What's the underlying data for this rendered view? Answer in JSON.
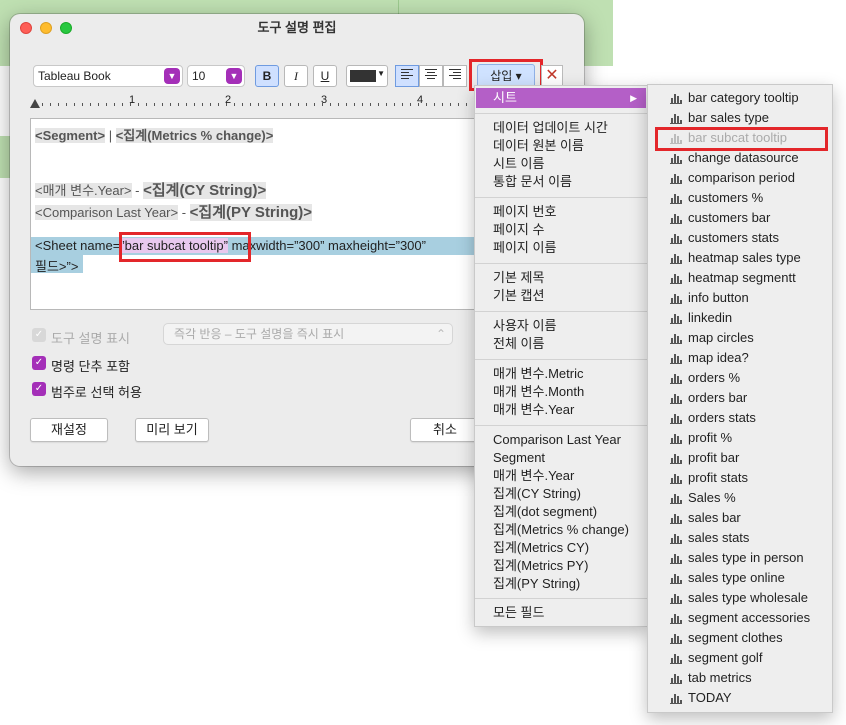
{
  "dialog": {
    "title": "도구 설명 편집",
    "font_family": "Tableau Book",
    "font_size": "10",
    "bold": "B",
    "italic": "I",
    "underline": "U",
    "insert_label": "삽입 ▾",
    "delete_glyph": "✕",
    "text_color": "#333333"
  },
  "ruler": [
    "1",
    "2",
    "3",
    "4"
  ],
  "editor": {
    "line1_a": "<Segment>",
    "line1_sep": " | ",
    "line1_b": "<집계(Metrics % change)>",
    "line2_a": "<매개 변수.Year>",
    "line2_sep": " - ",
    "line2_b": "<집계(CY String)>",
    "line3_a": "<Comparison Last Year>",
    "line3_sep": " - ",
    "line3_b": "<집계(PY String)>",
    "line4_prefix": "<Sheet name=",
    "line4_name": "”bar subcat tooltip”",
    "line4_suffix": " maxwidth=”300” maxheight=”300”",
    "line5": "필드>”>"
  },
  "options": {
    "show_tooltip": "도구 설명 표시",
    "mode": "즉각 반응 – 도구 설명을 즉시 표시",
    "include_commands": "명령 단추 포함",
    "allow_category": "범주로 선택 허용"
  },
  "buttons": {
    "reset": "재설정",
    "preview": "미리 보기",
    "cancel": "취소"
  },
  "insert_menu": {
    "sheet": "시트",
    "group1": [
      "데이터 업데이트 시간",
      "데이터 원본 이름",
      "시트 이름",
      "통합 문서 이름"
    ],
    "group2": [
      "페이지 번호",
      "페이지 수",
      "페이지 이름"
    ],
    "group3": [
      "기본 제목",
      "기본 캡션"
    ],
    "group4": [
      "사용자 이름",
      "전체 이름"
    ],
    "group5": [
      "매개 변수.Metric",
      "매개 변수.Month",
      "매개 변수.Year"
    ],
    "group6": [
      "Comparison Last Year",
      "Segment",
      "매개 변수.Year",
      "집계(CY String)",
      "집계(dot segment)",
      "집계(Metrics % change)",
      "집계(Metrics CY)",
      "집계(Metrics PY)",
      "집계(PY String)"
    ],
    "group7": [
      "모든 필드"
    ]
  },
  "sheets_menu": [
    "bar category tooltip",
    "bar sales type",
    "bar subcat tooltip",
    "change datasource",
    "comparison period",
    "customers %",
    "customers bar",
    "customers stats",
    "heatmap sales type",
    "heatmap segmentt",
    "info button",
    "linkedin",
    "map circles",
    "map idea?",
    "orders %",
    "orders bar",
    "orders stats",
    "profit %",
    "profit bar",
    "profit stats",
    "Sales %",
    "sales bar",
    "sales stats",
    "sales type in person",
    "sales type online",
    "sales type wholesale",
    "segment accessories",
    "segment clothes",
    "segment golf",
    "tab metrics",
    "TODAY"
  ],
  "colors": {
    "accent_purple": "#a42fb8",
    "menu_highlight": "#b45fc7",
    "annotation_red": "#e3262a",
    "selection": "#a8cfe0"
  }
}
